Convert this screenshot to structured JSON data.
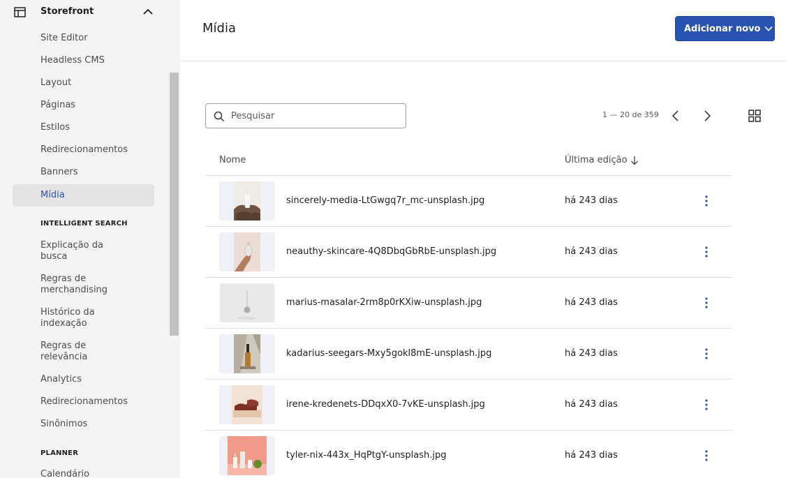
{
  "sidebar": {
    "header": {
      "title": "Storefront",
      "icon": "layout-icon",
      "toggle_icon": "chevron-up-icon"
    },
    "storefront_items": [
      {
        "label": "Site Editor"
      },
      {
        "label": "Headless CMS"
      },
      {
        "label": "Layout"
      },
      {
        "label": "Páginas"
      },
      {
        "label": "Estilos"
      },
      {
        "label": "Redirecionamentos"
      },
      {
        "label": "Banners"
      },
      {
        "label": "Mídia",
        "active": true
      }
    ],
    "intelligent_search": {
      "title": "INTELLIGENT SEARCH",
      "items": [
        {
          "line1": "Explicação da",
          "line2": "busca"
        },
        {
          "line1": "Regras de",
          "line2": "merchandising"
        },
        {
          "line1": "Histórico da",
          "line2": "indexação"
        },
        {
          "line1": "Regras de",
          "line2": "relevância"
        },
        {
          "label": "Analytics"
        },
        {
          "label": "Redirecionamentos"
        },
        {
          "label": "Sinônimos"
        }
      ]
    },
    "planner": {
      "title": "PLANNER",
      "items": [
        {
          "label": "Calendário"
        }
      ]
    },
    "accent_color": "#2953b2"
  },
  "header": {
    "title": "Mídia",
    "add_button_label": "Adicionar novo"
  },
  "toolbar": {
    "search_placeholder": "Pesquisar",
    "pagination_text": "1 — 20 de 359",
    "prev_icon": "chevron-left-icon",
    "next_icon": "chevron-right-icon",
    "view_icon": "grid-view-icon"
  },
  "table": {
    "columns": {
      "name": "Nome",
      "last_edit": "Última edição"
    },
    "sort_icon": "arrow-down-icon",
    "rows": [
      {
        "name": "sincerely-media-LtGwgq7r_mc-unsplash.jpg",
        "edited": "há 243 dias",
        "thumb": "bottle-on-rocks"
      },
      {
        "name": "neauthy-skincare-4Q8DbqGbRbE-unsplash.jpg",
        "edited": "há 243 dias",
        "thumb": "hand-with-bottle"
      },
      {
        "name": "marius-masalar-2rm8p0rKXiw-unsplash.jpg",
        "edited": "há 243 dias",
        "thumb": "dropper-white"
      },
      {
        "name": "kadarius-seegars-Mxy5gokl8mE-unsplash.jpg",
        "edited": "há 243 dias",
        "thumb": "amber-bottle-shadow"
      },
      {
        "name": "irene-kredenets-DDqxX0-7vKE-unsplash.jpg",
        "edited": "há 243 dias",
        "thumb": "shoes-on-blocks"
      },
      {
        "name": "tyler-nix-443x_HqPtgY-unsplash.jpg",
        "edited": "há 243 dias",
        "thumb": "products-pink"
      }
    ],
    "row_menu_icon": "more-vertical-icon"
  }
}
